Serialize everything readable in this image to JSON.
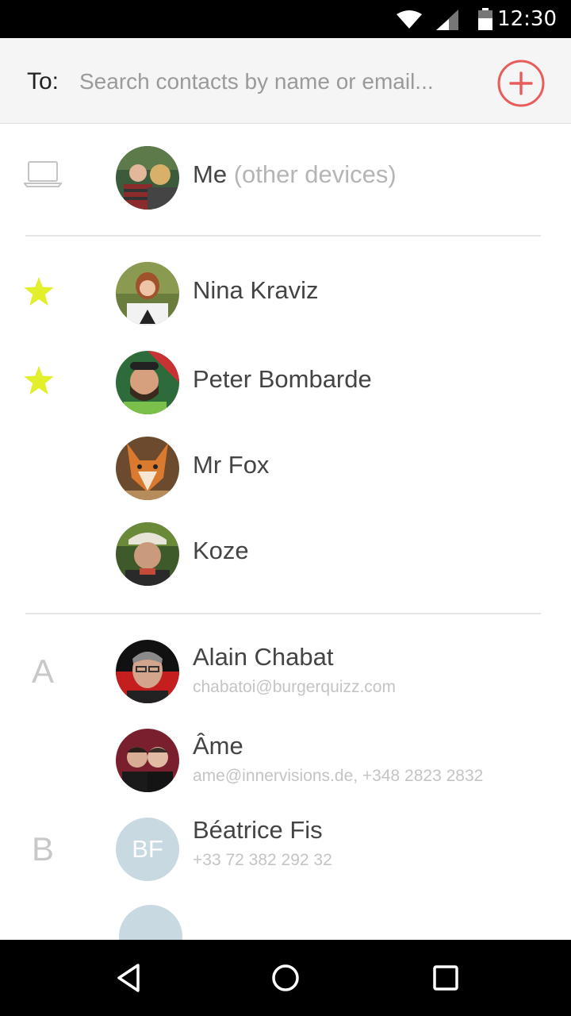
{
  "status_bar": {
    "time": "12:30"
  },
  "to_bar": {
    "label": "To:",
    "placeholder": "Search contacts by name or email...",
    "add_color": "#e85c5c"
  },
  "me_row": {
    "name": "Me",
    "extra": "(other devices)"
  },
  "favorites": [
    {
      "name": "Nina Kraviz",
      "starred": true
    },
    {
      "name": "Peter Bombarde",
      "starred": true
    },
    {
      "name": "Mr Fox",
      "starred": false
    },
    {
      "name": "Koze",
      "starred": false
    }
  ],
  "sections": [
    {
      "letter": "A",
      "contacts": [
        {
          "name": "Alain Chabat",
          "detail": "chabatoi@burgerquizz.com"
        },
        {
          "name": "Âme",
          "detail": "ame@innervisions.de, +348 2823 2832"
        }
      ]
    },
    {
      "letter": "B",
      "contacts": [
        {
          "name": "Béatrice Fis",
          "detail": "+33 72 382 292 32",
          "initials": "BF"
        }
      ]
    }
  ],
  "colors": {
    "star": "#e3ef2b",
    "avatar_placeholder": "#c9d9e2"
  }
}
